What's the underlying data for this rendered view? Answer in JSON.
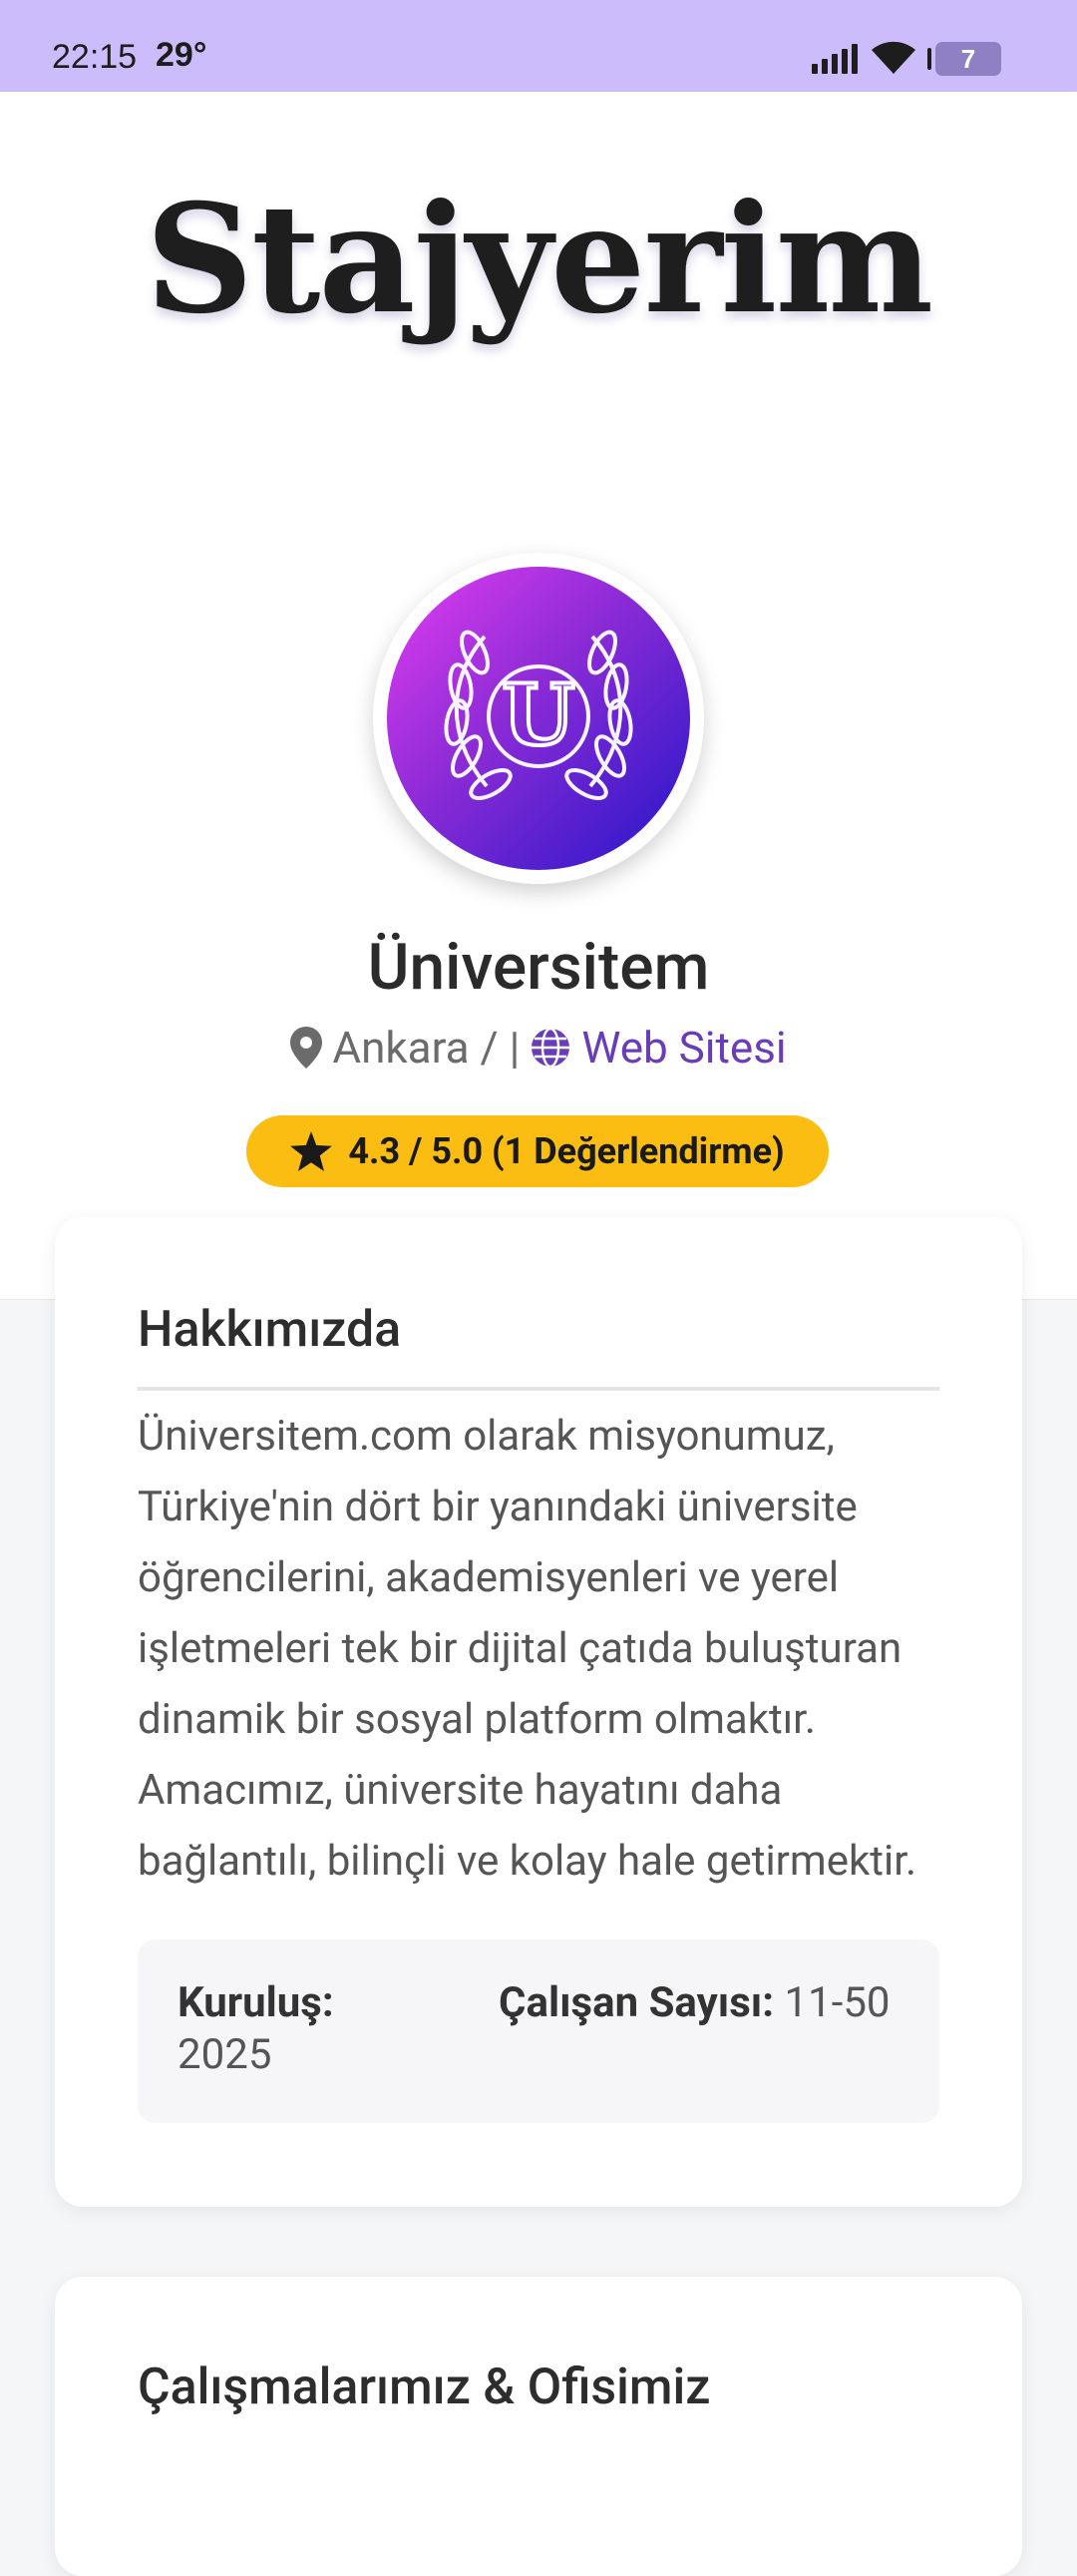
{
  "status": {
    "time": "22:15",
    "temp": "29°",
    "battery": "7"
  },
  "app": {
    "brand": "Stajyerim"
  },
  "company": {
    "logo_letter": "U",
    "name": "Üniversitem",
    "location": "Ankara / |",
    "website_label": "Web Sitesi",
    "rating": "4.3 / 5.0 (1 Değerlendirme)"
  },
  "about": {
    "title": "Hakkımızda",
    "text": "Üniversitem.com olarak misyonumuz, Türkiye'nin dört bir yanındaki üniversite öğrencilerini, akademisyenleri ve yerel işletmeleri tek bir dijital çatıda buluşturan dinamik bir sosyal platform olmaktır. Amacımız, üniversite hayatını daha bağlantılı, bilinçli ve kolay hale getirmektir.",
    "founded_label": "Kuruluş:",
    "founded_value": "2025",
    "employees_label": "Çalışan Sayısı:",
    "employees_value": "11-50"
  },
  "work": {
    "title": "Çalışmalarımız & Ofisimiz"
  },
  "colors": {
    "accent": "#6a3db8",
    "rating_bg": "#fbbd12",
    "statusbar": "#cdbcfb"
  }
}
